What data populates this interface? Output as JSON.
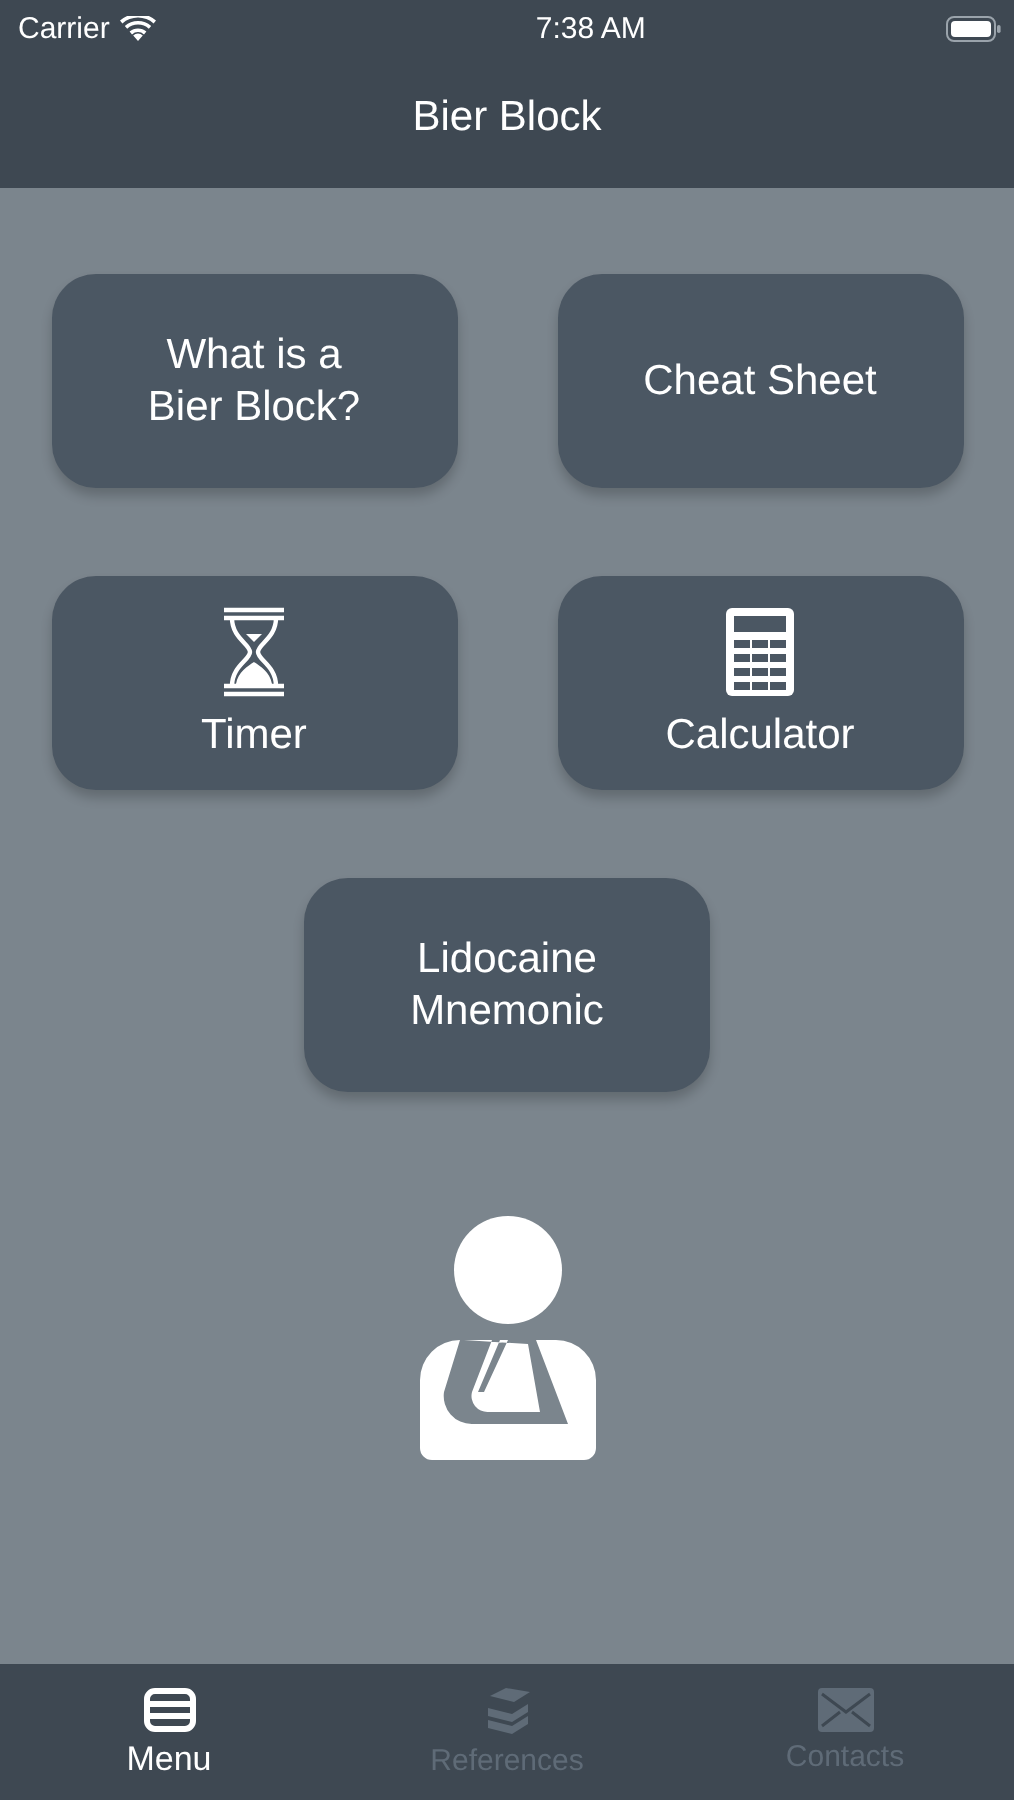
{
  "status_bar": {
    "carrier": "Carrier",
    "time": "7:38 AM"
  },
  "nav_bar": {
    "title": "Bier Block"
  },
  "buttons": [
    {
      "label": "What is a Bier Block?",
      "kind": "text"
    },
    {
      "label": "Cheat Sheet",
      "kind": "text"
    },
    {
      "label": "Timer",
      "kind": "icon"
    },
    {
      "label": "Calculator",
      "kind": "icon"
    },
    {
      "label": "Lidocaine Mnemonic",
      "kind": "text"
    }
  ],
  "tabs": [
    {
      "label": "Menu",
      "selected": true
    },
    {
      "label": "References",
      "selected": false
    },
    {
      "label": "Contacts",
      "selected": false
    }
  ]
}
